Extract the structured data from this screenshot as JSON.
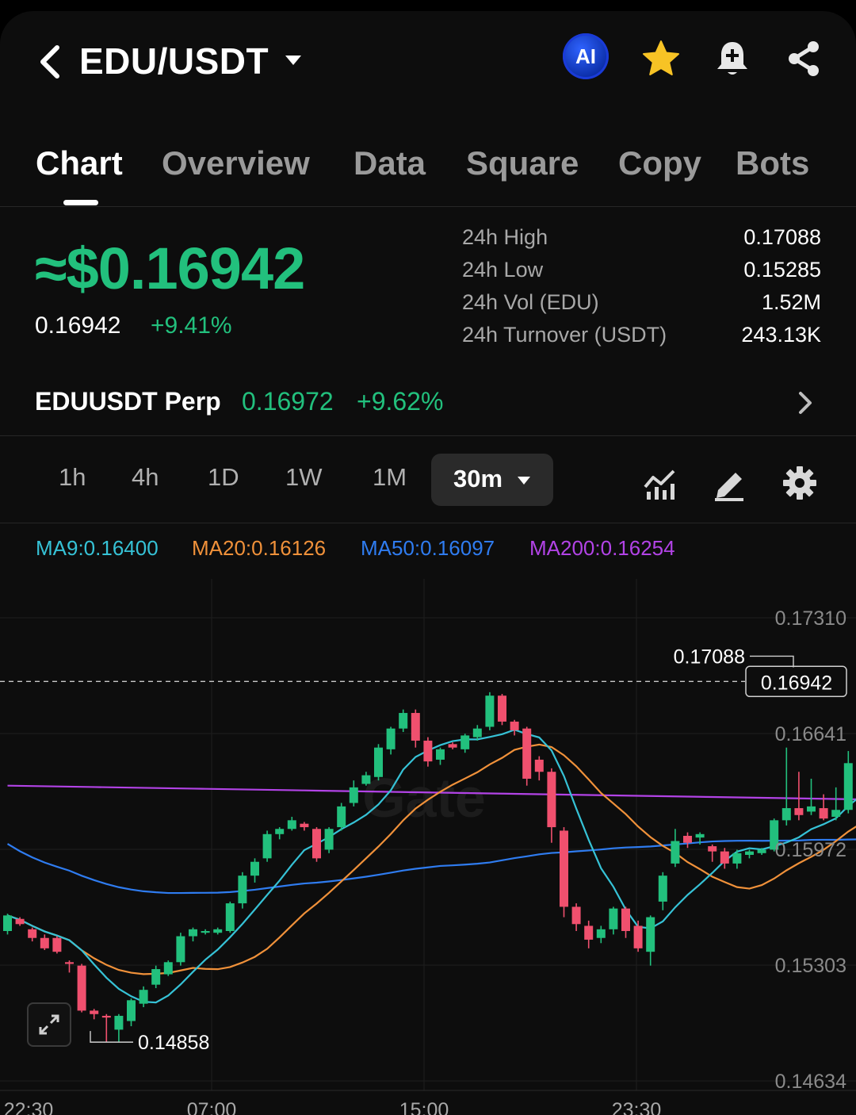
{
  "header": {
    "pair": "EDU/USDT",
    "ai_label": "AI"
  },
  "tabs": [
    "Chart",
    "Overview",
    "Data",
    "Square",
    "Copy",
    "Bots"
  ],
  "price": {
    "big": "≈$0.16942",
    "last": "0.16942",
    "change": "+9.41%",
    "colors": {
      "up": "#22c07d",
      "down": "#f0506e"
    }
  },
  "stats": [
    {
      "label": "24h High",
      "value": "0.17088"
    },
    {
      "label": "24h Low",
      "value": "0.15285"
    },
    {
      "label": "24h Vol (EDU)",
      "value": "1.52M"
    },
    {
      "label": "24h Turnover (USDT)",
      "value": "243.13K"
    }
  ],
  "perp": {
    "name": "EDUUSDT Perp",
    "price": "0.16972",
    "change": "+9.62%"
  },
  "intervals": [
    "1h",
    "4h",
    "1D",
    "1W",
    "1M"
  ],
  "selected_interval": "30m",
  "ma_legend": [
    {
      "label": "MA9:0.16400",
      "color": "#36c2d6"
    },
    {
      "label": "MA20:0.16126",
      "color": "#f0913a"
    },
    {
      "label": "MA50:0.16097",
      "color": "#2f7cf0"
    },
    {
      "label": "MA200:0.16254",
      "color": "#b243e6"
    }
  ],
  "chart_data": {
    "type": "candlestick",
    "y_ticks": [
      0.1731,
      0.16641,
      0.15972,
      0.15303,
      0.14634
    ],
    "y_tick_labels": [
      "0.17310",
      "0.16641",
      "0.15972",
      "0.15303",
      "0.14634"
    ],
    "x_tick_labels": [
      "22:30",
      "07:00",
      "15:00",
      "23:30"
    ],
    "ylim": [
      0.14634,
      0.1731
    ],
    "current_price_label": "0.16942",
    "current_price": 0.16942,
    "high_marker": {
      "label": "0.17088",
      "value": 0.17088
    },
    "low_marker": {
      "label": "0.14858",
      "value": 0.14858
    },
    "watermark": "Gate",
    "candles": [
      [
        0.155,
        0.1559,
        0.1548,
        0.156
      ],
      [
        0.1557,
        0.1554,
        0.1553,
        0.1558
      ],
      [
        0.1551,
        0.1546,
        0.1544,
        0.1552
      ],
      [
        0.1546,
        0.154,
        0.1539,
        0.1548
      ],
      [
        0.1546,
        0.1538,
        0.1537,
        0.1547
      ],
      [
        0.1532,
        0.1531,
        0.1526,
        0.1533
      ],
      [
        0.153,
        0.1504,
        0.1503,
        0.1531
      ],
      [
        0.1504,
        0.1502,
        0.1499,
        0.1505
      ],
      [
        0.1501,
        0.15,
        0.1486,
        0.1502
      ],
      [
        0.1493,
        0.1501,
        0.1486,
        0.1502
      ],
      [
        0.1498,
        0.151,
        0.1495,
        0.1511
      ],
      [
        0.1508,
        0.1516,
        0.1506,
        0.1518
      ],
      [
        0.1519,
        0.1528,
        0.1517,
        0.153
      ],
      [
        0.1525,
        0.1532,
        0.1524,
        0.1533
      ],
      [
        0.1532,
        0.1547,
        0.153,
        0.1549
      ],
      [
        0.1547,
        0.1551,
        0.1544,
        0.1552
      ],
      [
        0.1549,
        0.155,
        0.1548,
        0.1551
      ],
      [
        0.1549,
        0.1551,
        0.1548,
        0.1552
      ],
      [
        0.155,
        0.1566,
        0.1549,
        0.1567
      ],
      [
        0.1566,
        0.1582,
        0.1563,
        0.1584
      ],
      [
        0.1582,
        0.159,
        0.1578,
        0.1592
      ],
      [
        0.1592,
        0.1606,
        0.159,
        0.1608
      ],
      [
        0.1606,
        0.1609,
        0.1603,
        0.161
      ],
      [
        0.1609,
        0.1614,
        0.1608,
        0.1616
      ],
      [
        0.1612,
        0.161,
        0.1608,
        0.1613
      ],
      [
        0.1609,
        0.1592,
        0.159,
        0.161
      ],
      [
        0.1597,
        0.1609,
        0.1595,
        0.161
      ],
      [
        0.161,
        0.1622,
        0.1608,
        0.1624
      ],
      [
        0.1624,
        0.1633,
        0.1622,
        0.1637
      ],
      [
        0.1635,
        0.164,
        0.1634,
        0.1642
      ],
      [
        0.1639,
        0.1656,
        0.1637,
        0.1658
      ],
      [
        0.1655,
        0.1667,
        0.1652,
        0.1668
      ],
      [
        0.1667,
        0.1676,
        0.1665,
        0.1678
      ],
      [
        0.1676,
        0.166,
        0.1656,
        0.1678
      ],
      [
        0.166,
        0.1648,
        0.1645,
        0.1662
      ],
      [
        0.1649,
        0.1655,
        0.1646,
        0.1656
      ],
      [
        0.1658,
        0.1656,
        0.1655,
        0.1659
      ],
      [
        0.1655,
        0.1663,
        0.1653,
        0.1664
      ],
      [
        0.1662,
        0.1667,
        0.166,
        0.1669
      ],
      [
        0.1668,
        0.1686,
        0.1666,
        0.1688
      ],
      [
        0.1686,
        0.1671,
        0.1669,
        0.1687
      ],
      [
        0.1671,
        0.1666,
        0.1663,
        0.1672
      ],
      [
        0.1667,
        0.1638,
        0.1634,
        0.1668
      ],
      [
        0.1649,
        0.1642,
        0.1637,
        0.1651
      ],
      [
        0.1642,
        0.161,
        0.1601,
        0.1644
      ],
      [
        0.1608,
        0.1564,
        0.1558,
        0.161
      ],
      [
        0.1564,
        0.1554,
        0.155,
        0.1566
      ],
      [
        0.1553,
        0.1545,
        0.154,
        0.1556
      ],
      [
        0.1546,
        0.1551,
        0.1543,
        0.1553
      ],
      [
        0.1551,
        0.1563,
        0.1548,
        0.1564
      ],
      [
        0.1563,
        0.155,
        0.1546,
        0.1564
      ],
      [
        0.1553,
        0.154,
        0.1538,
        0.1556
      ],
      [
        0.1538,
        0.1558,
        0.153,
        0.1559
      ],
      [
        0.1567,
        0.1582,
        0.1562,
        0.1584
      ],
      [
        0.1589,
        0.1602,
        0.1587,
        0.1609
      ],
      [
        0.1605,
        0.1601,
        0.1598,
        0.1607
      ],
      [
        0.1604,
        0.1606,
        0.16,
        0.1607
      ],
      [
        0.1599,
        0.1596,
        0.159,
        0.16
      ],
      [
        0.1596,
        0.1589,
        0.1586,
        0.1598
      ],
      [
        0.1589,
        0.1595,
        0.1586,
        0.1597
      ],
      [
        0.1594,
        0.1596,
        0.1592,
        0.1597
      ],
      [
        0.1595,
        0.1597,
        0.1594,
        0.1598
      ],
      [
        0.1597,
        0.1614,
        0.1596,
        0.1615
      ],
      [
        0.1614,
        0.1621,
        0.1611,
        0.1656
      ],
      [
        0.1621,
        0.1617,
        0.1614,
        0.1642
      ],
      [
        0.1619,
        0.1622,
        0.1617,
        0.1638
      ],
      [
        0.1621,
        0.1615,
        0.1614,
        0.1629
      ],
      [
        0.1616,
        0.162,
        0.1614,
        0.1633
      ],
      [
        0.162,
        0.1647,
        0.1618,
        0.1654
      ],
      [
        0.1649,
        0.1654,
        0.1646,
        0.1662
      ],
      [
        0.1663,
        0.1669,
        0.166,
        0.1671
      ]
    ]
  }
}
